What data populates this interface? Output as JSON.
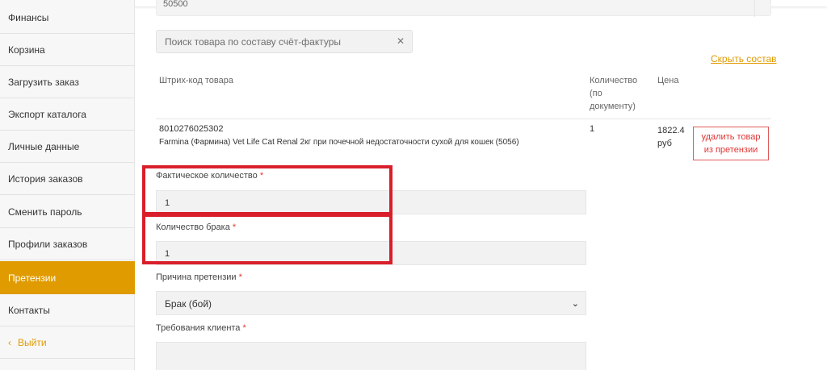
{
  "sidebar": {
    "items": [
      {
        "label": "Финансы"
      },
      {
        "label": "Корзина"
      },
      {
        "label": "Загрузить заказ"
      },
      {
        "label": "Экспорт каталога"
      },
      {
        "label": "Личные данные"
      },
      {
        "label": "История заказов"
      },
      {
        "label": "Сменить пароль"
      },
      {
        "label": "Профили заказов"
      },
      {
        "label": "Претензии",
        "active": true
      },
      {
        "label": "Контакты"
      }
    ],
    "logout": {
      "label": "Выйти",
      "icon": "chevron-left-icon"
    }
  },
  "top_field": {
    "value": "50500"
  },
  "search": {
    "placeholder": "Поиск товара по составу счёт-фактуры",
    "clear_icon": "close-icon"
  },
  "hide_link": "Скрыть состав",
  "table": {
    "headers": {
      "barcode": "Штрих-код товара",
      "quantity_1": "Количество",
      "quantity_2": "(по",
      "quantity_3": "документу)",
      "price": "Цена"
    },
    "row": {
      "barcode": "8010276025302",
      "name": "Farmina (Фармина) Vet Life Cat Renal 2кг при почечной недостаточности сухой для кошек (5056)",
      "quantity": "1",
      "price_1": "1822.4",
      "price_2": "руб",
      "delete_1": "удалить товар",
      "delete_2": "из претензии"
    }
  },
  "form": {
    "actual_qty": {
      "label": "Фактическое количество",
      "value": "1"
    },
    "defect_qty": {
      "label": "Количество брака",
      "value": "1"
    },
    "reason": {
      "label": "Причина претензии",
      "value": "Брак (бой)"
    },
    "requirements": {
      "label": "Требования клиента",
      "value": ""
    },
    "required_mark": "*"
  },
  "colors": {
    "accent": "#e09b00",
    "highlight": "#d91f2a",
    "danger": "#e03434"
  }
}
